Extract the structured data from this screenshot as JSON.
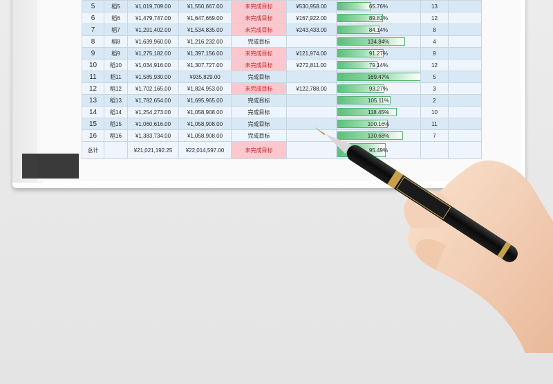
{
  "rows": [
    {
      "no": "5",
      "name": "稻5",
      "target": "¥1,019,709.00",
      "actual": "¥1,550,667.00",
      "status": "未完成目标",
      "status_type": "fail",
      "diff": "¥530,958.00",
      "pct_label": "65.76%",
      "pct": 0.6576,
      "rank": "13"
    },
    {
      "no": "6",
      "name": "稻6",
      "target": "¥1,479,747.00",
      "actual": "¥1,647,669.00",
      "status": "未完成目标",
      "status_type": "fail",
      "diff": "¥167,922.00",
      "pct_label": "89.81%",
      "pct": 0.8981,
      "rank": "12"
    },
    {
      "no": "7",
      "name": "稻7",
      "target": "¥1,291,402.00",
      "actual": "¥1,534,835.00",
      "status": "未完成目标",
      "status_type": "fail",
      "diff": "¥243,433.00",
      "pct_label": "84.14%",
      "pct": 0.8414,
      "rank": "8"
    },
    {
      "no": "8",
      "name": "稻8",
      "target": "¥1,639,960.00",
      "actual": "¥1,216,232.00",
      "status": "完成目标",
      "status_type": "ok",
      "diff": "",
      "pct_label": "134.84%",
      "pct": 1.3484,
      "rank": "4"
    },
    {
      "no": "9",
      "name": "稻9",
      "target": "¥1,275,182.00",
      "actual": "¥1,397,156.00",
      "status": "未完成目标",
      "status_type": "fail",
      "diff": "¥121,974.00",
      "pct_label": "91.27%",
      "pct": 0.9127,
      "rank": "9"
    },
    {
      "no": "10",
      "name": "稻10",
      "target": "¥1,034,916.00",
      "actual": "¥1,307,727.00",
      "status": "未完成目标",
      "status_type": "fail",
      "diff": "¥272,811.00",
      "pct_label": "79.14%",
      "pct": 0.7914,
      "rank": "12"
    },
    {
      "no": "11",
      "name": "稻11",
      "target": "¥1,585,930.00",
      "actual": "¥935,829.00",
      "status": "完成目标",
      "status_type": "ok",
      "diff": "",
      "pct_label": "169.47%",
      "pct": 1.6947,
      "rank": "5"
    },
    {
      "no": "12",
      "name": "稻12",
      "target": "¥1,702,165.00",
      "actual": "¥1,824,953.00",
      "status": "未完成目标",
      "status_type": "fail",
      "diff": "¥122,788.00",
      "pct_label": "93.27%",
      "pct": 0.9327,
      "rank": "3"
    },
    {
      "no": "13",
      "name": "稻13",
      "target": "¥1,782,654.00",
      "actual": "¥1,695,965.00",
      "status": "完成目标",
      "status_type": "ok",
      "diff": "",
      "pct_label": "105.11%",
      "pct": 1.0511,
      "rank": "2"
    },
    {
      "no": "14",
      "name": "稻14",
      "target": "¥1,254,273.00",
      "actual": "¥1,058,908.00",
      "status": "完成目标",
      "status_type": "ok",
      "diff": "",
      "pct_label": "118.45%",
      "pct": 1.1845,
      "rank": "10"
    },
    {
      "no": "15",
      "name": "稻15",
      "target": "¥1,060,616.00",
      "actual": "¥1,058,908.00",
      "status": "完成目标",
      "status_type": "ok",
      "diff": "",
      "pct_label": "100.16%",
      "pct": 1.0016,
      "rank": "11"
    },
    {
      "no": "16",
      "name": "稻16",
      "target": "¥1,383,734.00",
      "actual": "¥1,058,908.00",
      "status": "完成目标",
      "status_type": "ok",
      "diff": "",
      "pct_label": "130.68%",
      "pct": 1.3068,
      "rank": "7"
    }
  ],
  "total": {
    "label": "总计",
    "target": "¥21,021,192.25",
    "actual": "¥22,014,597.00",
    "status": "未完成目标",
    "status_type": "fail",
    "pct_label": "95.49%",
    "pct": 0.9549
  },
  "colors": {
    "row_even": "#d9e8f5",
    "row_odd": "#eef5fc",
    "fail_bg": "#fcc8cd",
    "fail_text": "#c0282d",
    "bar_green": "#5cc07a"
  }
}
